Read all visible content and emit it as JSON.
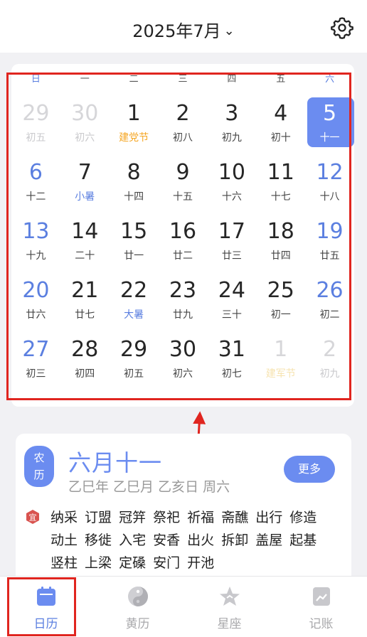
{
  "header": {
    "title": "2025年7月",
    "chevron": "⌄",
    "settings_icon": "gear-icon"
  },
  "calendar": {
    "weekdays": [
      "日",
      "一",
      "二",
      "三",
      "四",
      "五",
      "六"
    ],
    "days": [
      {
        "n": "29",
        "s": "初五",
        "state": "other"
      },
      {
        "n": "30",
        "s": "初六",
        "state": "other"
      },
      {
        "n": "1",
        "s": "建党节",
        "tag": "fest"
      },
      {
        "n": "2",
        "s": "初八"
      },
      {
        "n": "3",
        "s": "初九"
      },
      {
        "n": "4",
        "s": "初十"
      },
      {
        "n": "5",
        "s": "十一",
        "state": "sel"
      },
      {
        "n": "6",
        "s": "十二",
        "wk": true
      },
      {
        "n": "7",
        "s": "小暑",
        "tag": "term"
      },
      {
        "n": "8",
        "s": "十四"
      },
      {
        "n": "9",
        "s": "十五"
      },
      {
        "n": "10",
        "s": "十六"
      },
      {
        "n": "11",
        "s": "十七"
      },
      {
        "n": "12",
        "s": "十八",
        "wk": true
      },
      {
        "n": "13",
        "s": "十九",
        "wk": true
      },
      {
        "n": "14",
        "s": "二十"
      },
      {
        "n": "15",
        "s": "廿一"
      },
      {
        "n": "16",
        "s": "廿二"
      },
      {
        "n": "17",
        "s": "廿三"
      },
      {
        "n": "18",
        "s": "廿四"
      },
      {
        "n": "19",
        "s": "廿五",
        "wk": true
      },
      {
        "n": "20",
        "s": "廿六",
        "wk": true
      },
      {
        "n": "21",
        "s": "廿七"
      },
      {
        "n": "22",
        "s": "大暑",
        "tag": "term"
      },
      {
        "n": "23",
        "s": "廿九"
      },
      {
        "n": "24",
        "s": "三十"
      },
      {
        "n": "25",
        "s": "初一"
      },
      {
        "n": "26",
        "s": "初二",
        "wk": true
      },
      {
        "n": "27",
        "s": "初三",
        "wk": true
      },
      {
        "n": "28",
        "s": "初四"
      },
      {
        "n": "29",
        "s": "初五"
      },
      {
        "n": "30",
        "s": "初六"
      },
      {
        "n": "31",
        "s": "初七"
      },
      {
        "n": "1",
        "s": "建军节",
        "state": "other",
        "tag": "fest"
      },
      {
        "n": "2",
        "s": "初九",
        "state": "other"
      }
    ]
  },
  "almanac": {
    "badge": "农\n历",
    "lunar_date": "六月十一",
    "ganzhi": "乙巳年 乙巳月 乙亥日 周六",
    "more_label": "更多",
    "yi_label": "宜",
    "yi_items": "纳采 订盟 冠笄 祭祀 祈福 斋醮 出行 修造 动土 移徙 入宅 安香 出火 拆卸 盖屋 起基 竖柱 上梁 定磉 安门 开池"
  },
  "tabs": [
    {
      "label": "日历",
      "icon": "calendar-icon",
      "active": true
    },
    {
      "label": "黄历",
      "icon": "yin-yang-icon",
      "active": false
    },
    {
      "label": "星座",
      "icon": "star-icon",
      "active": false
    },
    {
      "label": "记账",
      "icon": "notebook-icon",
      "active": false
    }
  ],
  "colors": {
    "accent": "#6b8cf0",
    "festival": "#f5a623",
    "annotation": "#e0251f"
  }
}
